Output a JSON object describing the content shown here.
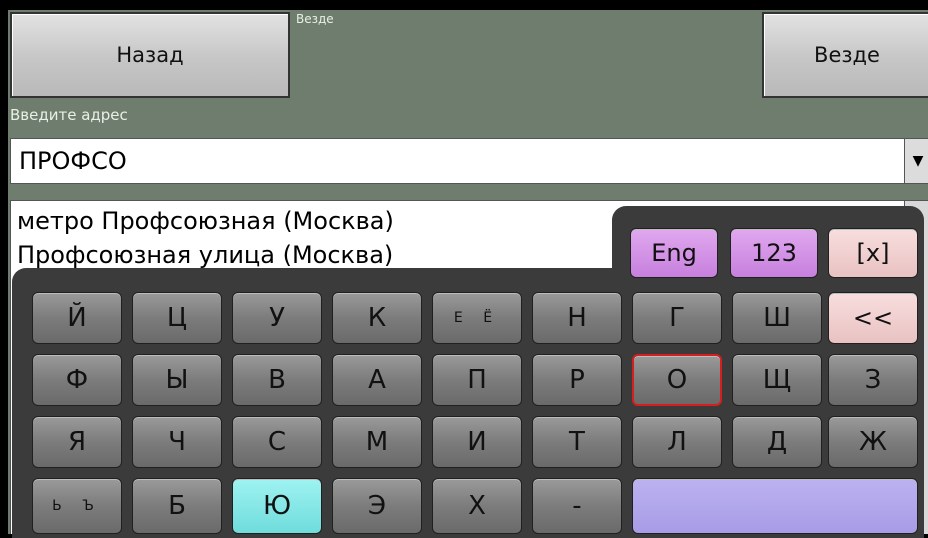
{
  "header": {
    "back_label": "Назад",
    "context_label": "Везде",
    "scope_button_label": "Везде"
  },
  "address": {
    "label": "Введите адрес",
    "value": "ПРОФСО"
  },
  "suggestions": [
    "метро Профсоюзная (Москва)",
    "Профсоюзная улица (Москва)"
  ],
  "keyboard": {
    "mode_eng": "Eng",
    "mode_num": "123",
    "close": "[x]",
    "backspace": "<<",
    "rows": [
      [
        "Й",
        "Ц",
        "У",
        "К",
        "Е Ё",
        "Н",
        "Г",
        "Ш"
      ],
      [
        "Ф",
        "Ы",
        "В",
        "А",
        "П",
        "Р",
        "О",
        "Щ",
        "З"
      ],
      [
        "Я",
        "Ч",
        "С",
        "М",
        "И",
        "Т",
        "Л",
        "Д",
        "Ж"
      ],
      [
        "Ь Ъ",
        "Б",
        "Ю",
        "Э",
        "Х",
        "-"
      ]
    ],
    "highlighted_key": "О",
    "colors": {
      "mode_keys": "#d79ae8",
      "close_keys": "#f0cfcf",
      "cyan_key": "#8ae8e6",
      "space_key": "#b3a8ec",
      "active_border": "#d41f1f"
    }
  }
}
